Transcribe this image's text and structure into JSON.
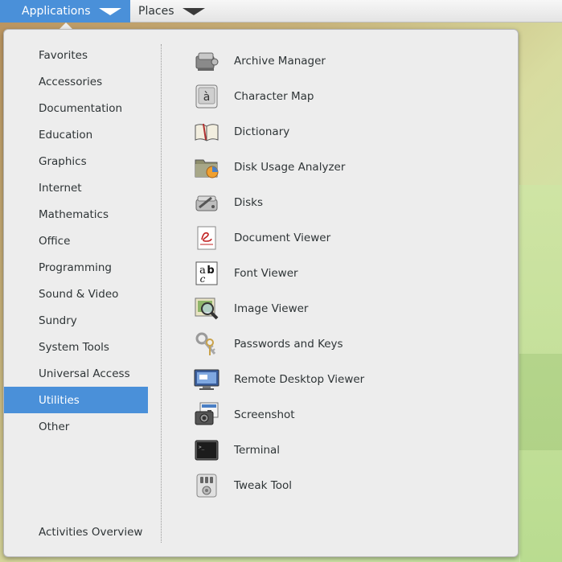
{
  "topbar": {
    "applications_label": "Applications",
    "places_label": "Places"
  },
  "categories": [
    {
      "label": "Favorites",
      "selected": false
    },
    {
      "label": "Accessories",
      "selected": false
    },
    {
      "label": "Documentation",
      "selected": false
    },
    {
      "label": "Education",
      "selected": false
    },
    {
      "label": "Graphics",
      "selected": false
    },
    {
      "label": "Internet",
      "selected": false
    },
    {
      "label": "Mathematics",
      "selected": false
    },
    {
      "label": "Office",
      "selected": false
    },
    {
      "label": "Programming",
      "selected": false
    },
    {
      "label": "Sound & Video",
      "selected": false
    },
    {
      "label": "Sundry",
      "selected": false
    },
    {
      "label": "System Tools",
      "selected": false
    },
    {
      "label": "Universal Access",
      "selected": false
    },
    {
      "label": "Utilities",
      "selected": true
    },
    {
      "label": "Other",
      "selected": false
    }
  ],
  "activities_overview_label": "Activities Overview",
  "apps": [
    {
      "label": "Archive Manager",
      "icon": "archive-manager-icon"
    },
    {
      "label": "Character Map",
      "icon": "character-map-icon"
    },
    {
      "label": "Dictionary",
      "icon": "dictionary-icon"
    },
    {
      "label": "Disk Usage Analyzer",
      "icon": "disk-usage-analyzer-icon"
    },
    {
      "label": "Disks",
      "icon": "disks-icon"
    },
    {
      "label": "Document Viewer",
      "icon": "document-viewer-icon"
    },
    {
      "label": "Font Viewer",
      "icon": "font-viewer-icon"
    },
    {
      "label": "Image Viewer",
      "icon": "image-viewer-icon"
    },
    {
      "label": "Passwords and Keys",
      "icon": "passwords-keys-icon"
    },
    {
      "label": "Remote Desktop Viewer",
      "icon": "remote-desktop-viewer-icon"
    },
    {
      "label": "Screenshot",
      "icon": "screenshot-icon"
    },
    {
      "label": "Terminal",
      "icon": "terminal-icon"
    },
    {
      "label": "Tweak Tool",
      "icon": "tweak-tool-icon"
    }
  ],
  "colors": {
    "accent": "#4a90d9",
    "menu_bg": "#ededed",
    "text": "#2e3436"
  }
}
